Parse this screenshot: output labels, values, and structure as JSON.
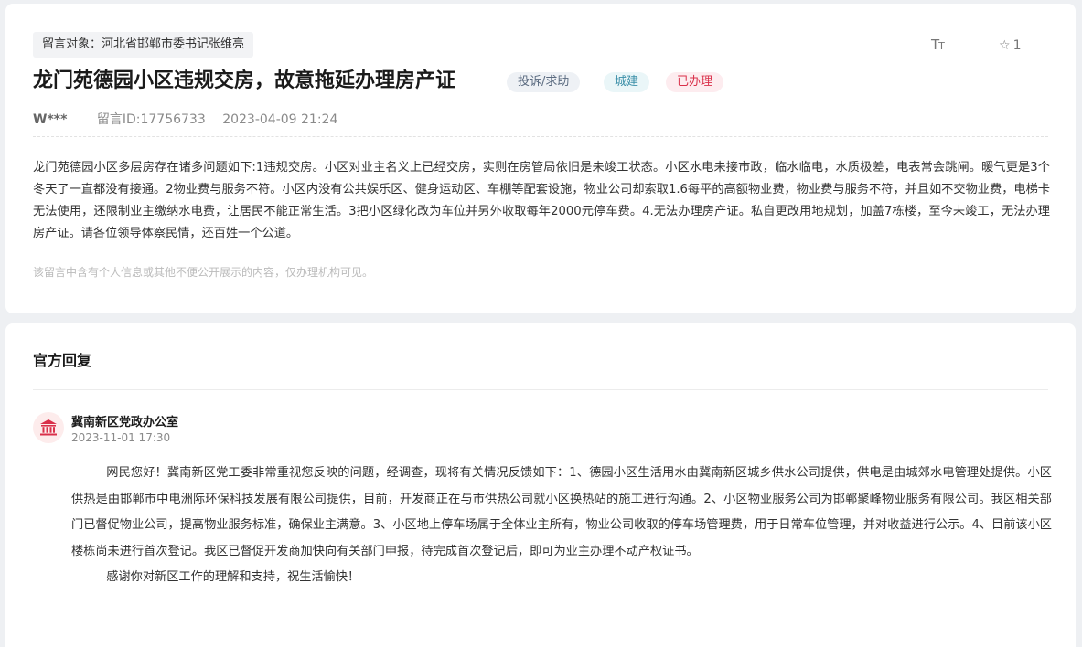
{
  "message": {
    "target_label": "留言对象：河北省邯郸市委书记张维亮",
    "font_toggle_label": "T",
    "font_toggle_small": "T",
    "favorite_count": "1",
    "title": "龙门苑德园小区违规交房，故意拖延办理房产证",
    "badges": {
      "type": "投诉/求助",
      "category": "城建",
      "status": "已办理"
    },
    "author": "W***",
    "message_id": "留言ID:17756733",
    "datetime": "2023-04-09 21:24",
    "content": "龙门苑德园小区多层房存在诸多问题如下:1违规交房。小区对业主名义上已经交房，实则在房管局依旧是未竣工状态。小区水电未接市政，临水临电，水质极差，电表常会跳闸。暖气更是3个冬天了一直都没有接通。2物业费与服务不符。小区内没有公共娱乐区、健身运动区、车棚等配套设施，物业公司却索取1.6每平的高额物业费，物业费与服务不符，并且如不交物业费，电梯卡无法使用，还限制业主缴纳水电费，让居民不能正常生活。3把小区绿化改为车位并另外收取每年2000元停车费。4.无法办理房产证。私自更改用地规划，加盖7栋楼，至今未竣工，无法办理房产证。请各位领导体察民情，还百姓一个公道。",
    "privacy_notice": "该留言中含有个人信息或其他不便公开展示的内容，仅办理机构可见。"
  },
  "reply": {
    "heading": "官方回复",
    "org_name": "冀南新区党政办公室",
    "datetime": "2023-11-01 17:30",
    "paragraph_1": "网民您好！冀南新区党工委非常重视您反映的问题，经调查，现将有关情况反馈如下：1、德园小区生活用水由冀南新区城乡供水公司提供，供电是由城郊水电管理处提供。小区供热是由邯郸市中电洲际环保科技发展有限公司提供，目前，开发商正在与市供热公司就小区换热站的施工进行沟通。2、小区物业服务公司为邯郸聚峰物业服务有限公司。我区相关部门已督促物业公司，提高物业服务标准，确保业主满意。3、小区地上停车场属于全体业主所有，物业公司收取的停车场管理费，用于日常车位管理，并对收益进行公示。4、目前该小区楼栋尚未进行首次登记。我区已督促开发商加快向有关部门申报，待完成首次登记后，即可为业主办理不动产权证书。",
    "paragraph_2": "感谢你对新区工作的理解和支持，祝生活愉快！"
  },
  "colors": {
    "status_red": "#d9304a",
    "category_teal": "#3b8fa8",
    "type_slate": "#5b6b80",
    "page_bg": "#eef0f3"
  },
  "icons": {
    "font_size": "font-size-icon",
    "favorite": "star-icon",
    "org": "government-building-icon"
  }
}
